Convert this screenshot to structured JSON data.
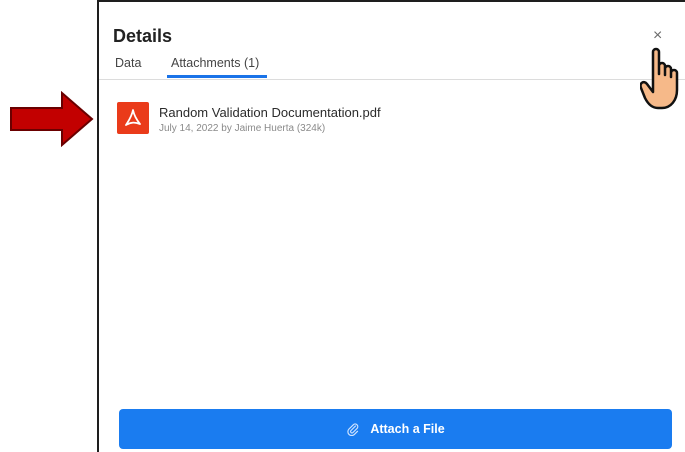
{
  "panel": {
    "title": "Details",
    "close_label": "×"
  },
  "tabs": [
    {
      "label": "Data",
      "active": false
    },
    {
      "label": "Attachments (1)",
      "active": true
    }
  ],
  "attachments": [
    {
      "file_name": "Random Validation Documentation.pdf",
      "meta": "July 14, 2022 by Jaime Huerta (324k)",
      "icon": "pdf-icon"
    }
  ],
  "footer": {
    "attach_button_label": "Attach a File",
    "attach_icon": "paperclip-icon"
  },
  "colors": {
    "accent": "#1a7cf0",
    "pdf": "#ea3b1a",
    "annotation_arrow": "#c20000"
  }
}
